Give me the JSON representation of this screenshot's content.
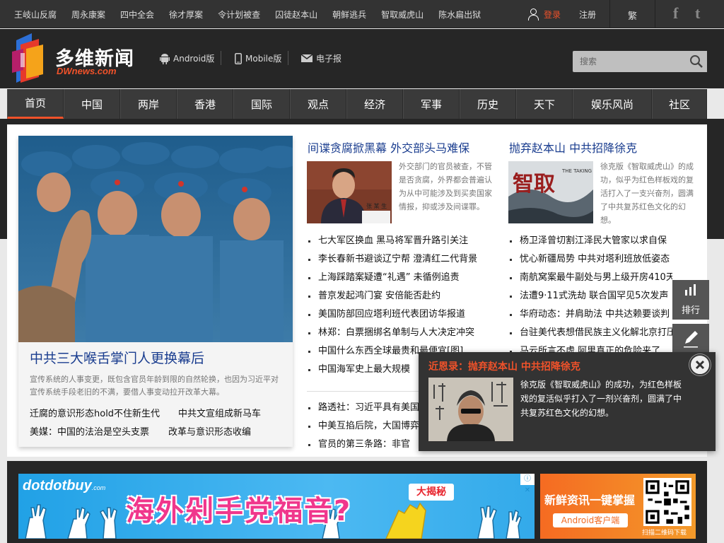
{
  "topbar": {
    "hot_links": [
      "王岐山反腐",
      "周永康案",
      "四中全会",
      "徐才厚案",
      "令计划被查",
      "囚徒赵本山",
      "朝鲜逃兵",
      "智取威虎山",
      "陈水扁出狱"
    ],
    "login": "登录",
    "register": "注册",
    "traditional": "繁",
    "social_facebook": "f",
    "social_twitter": "t"
  },
  "header": {
    "logo_cn": "多维新闻",
    "logo_en": "DWnews.com",
    "android": "Android版",
    "mobile": "Mobile版",
    "epaper": "电子报",
    "search_placeholder": "搜索"
  },
  "nav": {
    "items": [
      "首页",
      "中国",
      "两岸",
      "香港",
      "国际",
      "观点",
      "经济",
      "军事",
      "历史",
      "天下",
      "娱乐风尚",
      "社区"
    ],
    "active": "首页"
  },
  "hero": {
    "title": "中共三大喉舌掌门人更换幕后",
    "desc": "宣传系统的人事变更，既包含官员年龄到限的自然轮换，也因为习近平对宣传系统手段老旧的不满，要借人事变动拉开改革大幕。",
    "links": [
      "迁腐的意识形态hold不住新生代",
      "中共文宣组成新马车",
      "美媒：中国的法治是空头支票",
      "改革与意识形态收编"
    ]
  },
  "col2": {
    "title": "间谍贪腐掀黑幕 外交部头马难保",
    "desc": "外交部门的官员被查，不管是否贪腐，外界都会普遍认为从中可能涉及到买卖国家情报，抑或涉及间谍罪。",
    "list": [
      "七大军区换血 黑马将军晋升路引关注",
      "李长春新书避谈辽宁帮 澄清红二代背景",
      "上海踩踏案疑遭“礼遇” 未循例追责",
      "普京发起鸿门宴 安倍能否赴约",
      "美国防部回应塔利班代表团访华报道",
      "林郑：白票捆绑名单制与人大决定冲突",
      "中国什么东西全球最贵和最便宜[图]",
      "中国海军史上最大规模"
    ],
    "list2": [
      "路透社：习近平具有美国",
      "中美互掐后院，大国博弈",
      "官员的第三条路：非官"
    ]
  },
  "col3": {
    "title": "抛弃赵本山 中共招降徐克",
    "desc": "徐克版《智取威虎山》的成功，似乎为红色样板戏的复活打入了一支兴奋剂，圆满了中共复苏红色文化的幻想。",
    "list": [
      "杨卫泽曾切割江泽民大管家以求自保",
      "忧心新疆局势 中共对塔利班放低姿态",
      "南航窝案最牛副处与男上级开房410天",
      "法遭9·11式洗劫 联合国罕见5次发声",
      "华府动态：并肩助法 中共达赖要谈判",
      "台驻美代表想借民族主义化解北京打压",
      "马云所言不虚 阿里真正的危险来了"
    ]
  },
  "tools": {
    "rank": "排行",
    "comment": "评论"
  },
  "popup": {
    "title": "近恩录：抛弃赵本山 中共招降徐克",
    "desc": "徐克版《智取威虎山》的成功，为红色样板戏的复活似乎打入了一剂兴奋剂，圆满了中共复苏红色文化的幻想。"
  },
  "ads": {
    "brand": "dotdotbuy",
    "brand_suffix": ".com",
    "slogan": "海外剁手党福音?",
    "reveal": "大揭秘",
    "close": "ⓘ ✕",
    "qr_title": "新鲜资讯一键掌握",
    "qr_button": "Android客户端",
    "qr_caption": "扫描二维码下载"
  },
  "colors": {
    "accent": "#f0522a",
    "link_title": "#1a3d8f",
    "header_bg": "#262626",
    "nav_bg": "#3a3a3a"
  }
}
